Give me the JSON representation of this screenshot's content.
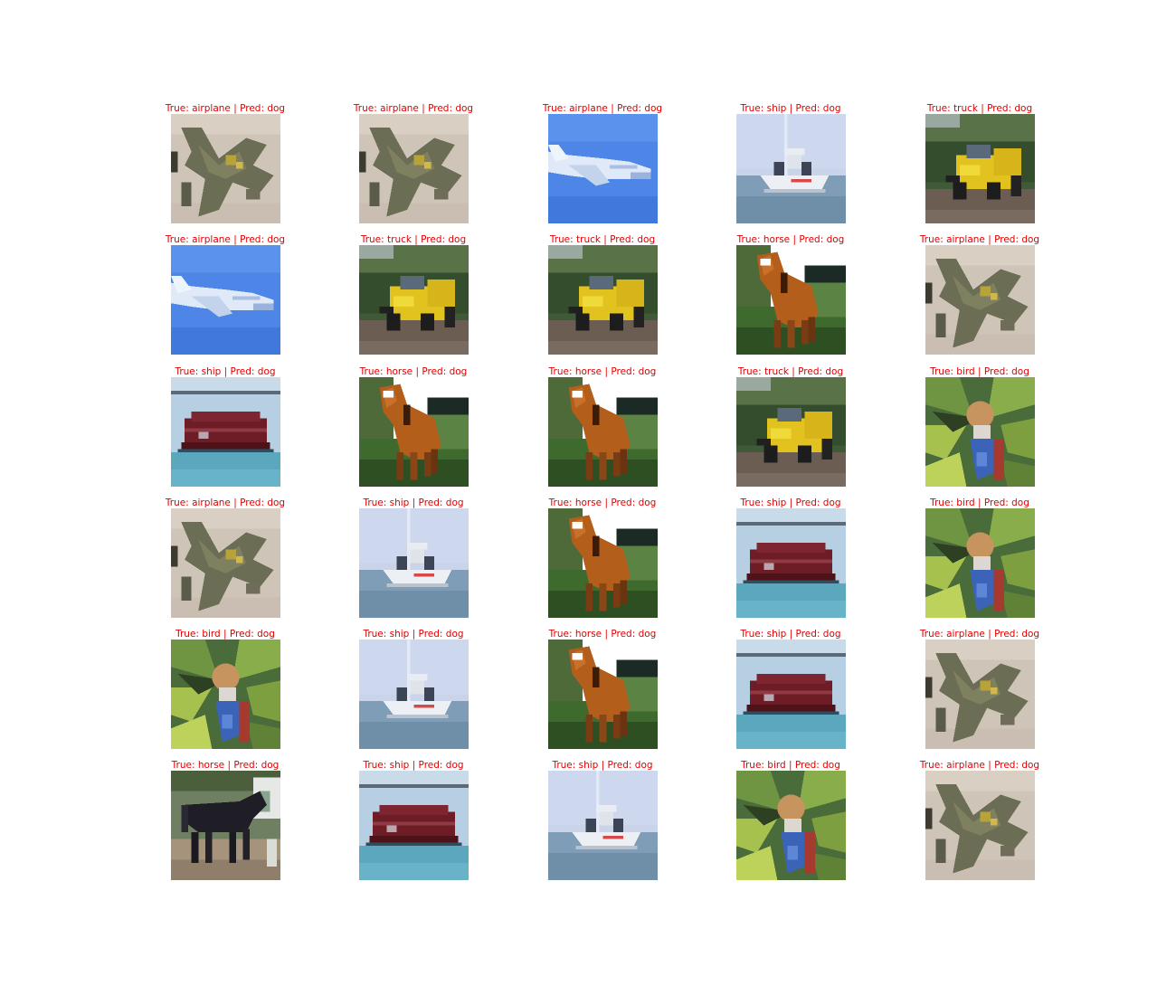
{
  "figure": {
    "panels": [
      [
        {
          "true_label": "airplane",
          "pred_label": "dog",
          "title": "True: airplane | Pred: dog",
          "image": "airplane-camo"
        },
        {
          "true_label": "airplane",
          "pred_label": "dog",
          "title": "True: airplane | Pred: dog",
          "image": "airplane-camo"
        },
        {
          "true_label": "airplane",
          "pred_label": "dog",
          "title": "True: airplane | Pred: dog",
          "image": "airplane-blue"
        },
        {
          "true_label": "ship",
          "pred_label": "dog",
          "title": "True: ship | Pred: dog",
          "image": "ship-boat"
        },
        {
          "true_label": "truck",
          "pred_label": "dog",
          "title": "True: truck | Pred: dog",
          "image": "truck-yellow"
        }
      ],
      [
        {
          "true_label": "airplane",
          "pred_label": "dog",
          "title": "True: airplane | Pred: dog",
          "image": "airplane-blue"
        },
        {
          "true_label": "truck",
          "pred_label": "dog",
          "title": "True: truck | Pred: dog",
          "image": "truck-yellow"
        },
        {
          "true_label": "truck",
          "pred_label": "dog",
          "title": "True: truck | Pred: dog",
          "image": "truck-yellow"
        },
        {
          "true_label": "horse",
          "pred_label": "dog",
          "title": "True: horse | Pred: dog",
          "image": "horse-brown"
        },
        {
          "true_label": "airplane",
          "pred_label": "dog",
          "title": "True: airplane | Pred: dog",
          "image": "airplane-camo"
        }
      ],
      [
        {
          "true_label": "ship",
          "pred_label": "dog",
          "title": "True: ship | Pred: dog",
          "image": "ship-red"
        },
        {
          "true_label": "horse",
          "pred_label": "dog",
          "title": "True: horse | Pred: dog",
          "image": "horse-brown"
        },
        {
          "true_label": "horse",
          "pred_label": "dog",
          "title": "True: horse | Pred: dog",
          "image": "horse-brown"
        },
        {
          "true_label": "truck",
          "pred_label": "dog",
          "title": "True: truck | Pred: dog",
          "image": "truck-yellow"
        },
        {
          "true_label": "bird",
          "pred_label": "dog",
          "title": "True: bird | Pred: dog",
          "image": "bird-leaves"
        }
      ],
      [
        {
          "true_label": "airplane",
          "pred_label": "dog",
          "title": "True: airplane | Pred: dog",
          "image": "airplane-camo"
        },
        {
          "true_label": "ship",
          "pred_label": "dog",
          "title": "True: ship | Pred: dog",
          "image": "ship-boat"
        },
        {
          "true_label": "horse",
          "pred_label": "dog",
          "title": "True: horse | Pred: dog",
          "image": "horse-brown"
        },
        {
          "true_label": "ship",
          "pred_label": "dog",
          "title": "True: ship | Pred: dog",
          "image": "ship-red"
        },
        {
          "true_label": "bird",
          "pred_label": "dog",
          "title": "True: bird | Pred: dog",
          "image": "bird-leaves"
        }
      ],
      [
        {
          "true_label": "bird",
          "pred_label": "dog",
          "title": "True: bird | Pred: dog",
          "image": "bird-leaves"
        },
        {
          "true_label": "ship",
          "pred_label": "dog",
          "title": "True: ship | Pred: dog",
          "image": "ship-boat"
        },
        {
          "true_label": "horse",
          "pred_label": "dog",
          "title": "True: horse | Pred: dog",
          "image": "horse-brown"
        },
        {
          "true_label": "ship",
          "pred_label": "dog",
          "title": "True: ship | Pred: dog",
          "image": "ship-red"
        },
        {
          "true_label": "airplane",
          "pred_label": "dog",
          "title": "True: airplane | Pred: dog",
          "image": "airplane-camo"
        }
      ],
      [
        {
          "true_label": "horse",
          "pred_label": "dog",
          "title": "True: horse | Pred: dog",
          "image": "horse-dark"
        },
        {
          "true_label": "ship",
          "pred_label": "dog",
          "title": "True: ship | Pred: dog",
          "image": "ship-red"
        },
        {
          "true_label": "ship",
          "pred_label": "dog",
          "title": "True: ship | Pred: dog",
          "image": "ship-boat"
        },
        {
          "true_label": "bird",
          "pred_label": "dog",
          "title": "True: bird | Pred: dog",
          "image": "bird-leaves"
        },
        {
          "true_label": "airplane",
          "pred_label": "dog",
          "title": "True: airplane | Pred: dog",
          "image": "airplane-camo"
        }
      ]
    ],
    "title_color": "#e00000"
  }
}
